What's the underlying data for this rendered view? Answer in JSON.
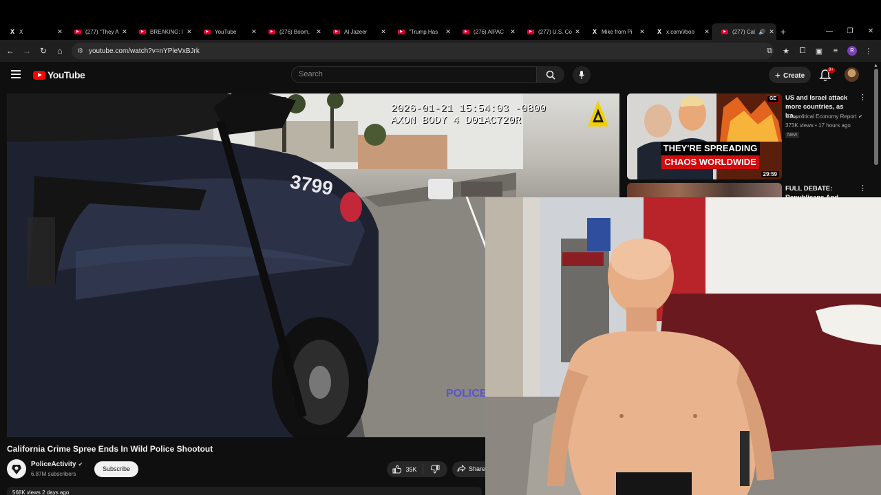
{
  "browser": {
    "tabs": [
      {
        "favicon": "x-icon",
        "title": "X"
      },
      {
        "favicon": "youtube-icon",
        "title": "(277) \"They A"
      },
      {
        "favicon": "youtube-icon",
        "title": "BREAKING: I"
      },
      {
        "favicon": "youtube-icon",
        "title": "YouTube"
      },
      {
        "favicon": "youtube-icon",
        "title": "(276) Boom,"
      },
      {
        "favicon": "youtube-icon",
        "title": "Al Jazeer"
      },
      {
        "favicon": "youtube-icon",
        "title": "\"Trump Has"
      },
      {
        "favicon": "youtube-icon",
        "title": "(276) AIPAC"
      },
      {
        "favicon": "youtube-icon",
        "title": "(277) U.S. Co"
      },
      {
        "favicon": "x-icon",
        "title": "Mike from Pi"
      },
      {
        "favicon": "x-icon",
        "title": "x.com/i/boo"
      },
      {
        "favicon": "youtube-icon",
        "title": "(277) Cal"
      }
    ],
    "url": "youtube.com/watch?v=nYPleVxBJrk",
    "profile_initial": "R"
  },
  "youtube": {
    "logo_text": "YouTube",
    "search_placeholder": "Search",
    "create_label": "Create",
    "notification_badge": "9+"
  },
  "player": {
    "overlay_line1": "2026-01-21 15:54:03 -0800",
    "overlay_line2": "AXON BODY 4 D01AC720R",
    "watermark": "POLICE"
  },
  "video": {
    "title": "California Crime Spree Ends In Wild Police Shootout",
    "channel": "PoliceActivity",
    "subscribers": "6.87M subscribers",
    "subscribe_label": "Subscribe",
    "likes": "35K",
    "share_label": "Share",
    "views_line": "568K views  2 days ago"
  },
  "recommendations": [
    {
      "title": "US and Israel attack more countries, as Ira...",
      "channel": "Geopolitical Economy Report",
      "meta": "373K views • 17 hours ago",
      "badge": "New",
      "duration": "29:59",
      "thumb_caption_line1": "THEY'RE SPREADING",
      "thumb_caption_line2": "CHAOS WORLDWIDE",
      "thumb_logo": "GE"
    },
    {
      "title": "FULL DEBATE: Republicans And"
    }
  ],
  "colors": {
    "yt_red": "#ff0000",
    "background": "#0f0f0f",
    "overlay_accent": "#f2d000"
  }
}
